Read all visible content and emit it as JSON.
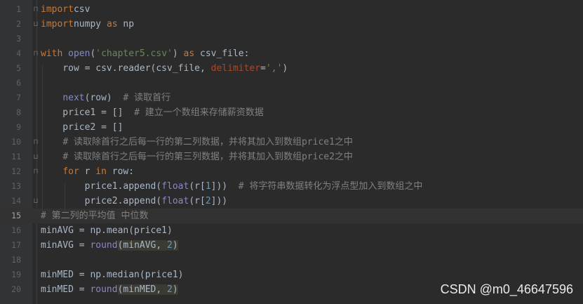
{
  "editor": {
    "current_line": 15,
    "lines": [
      {
        "n": "1",
        "tokens": [
          [
            "kw",
            "import"
          ],
          [
            "",
            "csv"
          ]
        ]
      },
      {
        "n": "2",
        "tokens": [
          [
            "kw",
            "import"
          ],
          [
            "",
            "numpy "
          ],
          [
            "kw",
            "as"
          ],
          [
            "",
            " np"
          ]
        ]
      },
      {
        "n": "3",
        "tokens": []
      },
      {
        "n": "4",
        "tokens": [
          [
            "kw",
            "with "
          ],
          [
            "bi",
            "open"
          ],
          [
            "",
            "("
          ],
          [
            "st",
            "'chapter5.csv'"
          ],
          [
            "",
            ") "
          ],
          [
            "kw",
            "as"
          ],
          [
            "",
            " csv_file:"
          ]
        ]
      },
      {
        "n": "5",
        "tokens": [
          [
            "",
            "    row = csv.reader(csv_file, "
          ],
          [
            "pa",
            "delimiter"
          ],
          [
            "",
            "="
          ],
          [
            "st",
            "','"
          ],
          [
            "",
            ")"
          ]
        ]
      },
      {
        "n": "6",
        "tokens": []
      },
      {
        "n": "7",
        "tokens": [
          [
            "",
            "    "
          ],
          [
            "mc",
            "next"
          ],
          [
            "",
            "(row)  "
          ],
          [
            "cm",
            "# 读取首行"
          ]
        ]
      },
      {
        "n": "8",
        "tokens": [
          [
            "",
            "    price1 = []  "
          ],
          [
            "cm",
            "# 建立一个数组来存储薪资数据"
          ]
        ]
      },
      {
        "n": "9",
        "tokens": [
          [
            "",
            "    price2 = []"
          ]
        ]
      },
      {
        "n": "10",
        "tokens": [
          [
            "",
            "    "
          ],
          [
            "cm",
            "# 读取除首行之后每一行的第二列数据，并将其加入到数组price1之中"
          ]
        ]
      },
      {
        "n": "11",
        "tokens": [
          [
            "",
            "    "
          ],
          [
            "cm",
            "# 读取除首行之后每一行的第三列数据，并将其加入到数组price2之中"
          ]
        ]
      },
      {
        "n": "12",
        "tokens": [
          [
            "",
            "    "
          ],
          [
            "kw",
            "for"
          ],
          [
            "",
            " r "
          ],
          [
            "kw",
            "in"
          ],
          [
            "",
            " row:"
          ]
        ]
      },
      {
        "n": "13",
        "tokens": [
          [
            "",
            "        price1.append("
          ],
          [
            "bi",
            "float"
          ],
          [
            "",
            "(r["
          ],
          [
            "nu",
            "1"
          ],
          [
            "",
            "]))  "
          ],
          [
            "cm",
            "# 将字符串数据转化为浮点型加入到数组之中"
          ]
        ]
      },
      {
        "n": "14",
        "tokens": [
          [
            "",
            "        price2.append("
          ],
          [
            "bi",
            "float"
          ],
          [
            "",
            "(r["
          ],
          [
            "nu",
            "2"
          ],
          [
            "",
            "]))"
          ]
        ]
      },
      {
        "n": "15",
        "tokens": [
          [
            "cm",
            "# 第二列的平均值 中位数"
          ]
        ]
      },
      {
        "n": "16",
        "tokens": [
          [
            "",
            "minAVG = np.mean(price1)"
          ]
        ]
      },
      {
        "n": "17",
        "tokens": [
          [
            "",
            "minAVG = "
          ],
          [
            "bi",
            "round"
          ],
          [
            "hl",
            "(minAVG, "
          ],
          [
            "hlnu",
            "2"
          ],
          [
            "hl",
            ")"
          ]
        ]
      },
      {
        "n": "18",
        "tokens": []
      },
      {
        "n": "19",
        "tokens": [
          [
            "",
            "minMED = np.median(price1)"
          ]
        ]
      },
      {
        "n": "20",
        "tokens": [
          [
            "",
            "minMED = "
          ],
          [
            "bi",
            "round"
          ],
          [
            "hl",
            "(minMED, "
          ],
          [
            "hlnu",
            "2"
          ],
          [
            "hl",
            ")"
          ]
        ]
      }
    ],
    "fold_markers": {
      "1": "⊓",
      "2": "⊔",
      "4": "⊓",
      "10": "⊓",
      "11": "⊔",
      "12": "⊓",
      "14": "⊔"
    }
  },
  "watermark": "CSDN @m0_46647596"
}
